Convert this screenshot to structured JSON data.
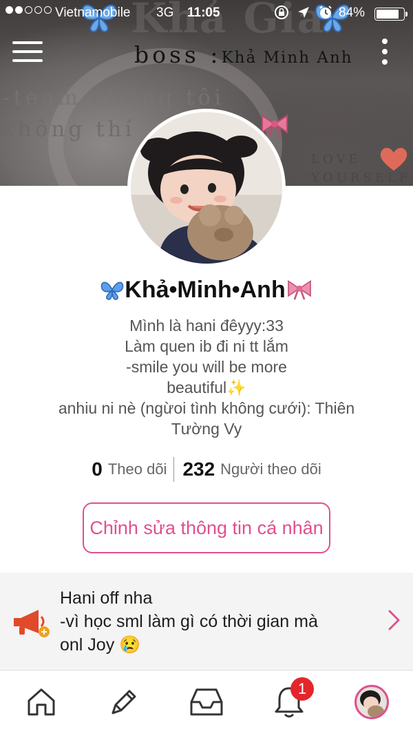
{
  "status_bar": {
    "carrier": "Vietnamobile",
    "network": "3G",
    "time": "11:05",
    "battery_percent": "84%",
    "battery_level": 0.84,
    "signal_bars_filled": 2,
    "signal_bars_total": 5
  },
  "banner": {
    "watermark_text": "Khả Gia",
    "boss_label": "boss :",
    "boss_name": "Khả Minh Anh",
    "team_line": "-team chúng tôi",
    "team_line2": "không thí",
    "love_line1": "LOVE",
    "love_line2": "YOURSELF"
  },
  "profile": {
    "name": "Khả•Minh•Anh",
    "name_prefix_emoji": "butterfly",
    "name_suffix_emoji": "ribbon",
    "bio_lines": [
      "Mình là hani đêyyy:33",
      "Làm quen ib đi ni tt lắm",
      "-smile you will be more",
      "beautiful✨",
      "anhiu ni nè (ngừoi tình không cưới): Thiên",
      "Tường Vy"
    ],
    "following_count": "0",
    "following_label": "Theo dõi",
    "followers_count": "232",
    "followers_label": "Người theo dõi",
    "edit_button_label": "Chỉnh sửa thông tin cá nhân"
  },
  "notice": {
    "lines": [
      "Hani off nha",
      "-vì học sml làm gì có thời gian mà",
      "onl Joy 😢"
    ]
  },
  "tabbar": {
    "notifications_badge": "1",
    "tabs": [
      "home-icon",
      "pencil-icon",
      "inbox-icon",
      "bell-icon",
      "profile-avatar"
    ]
  },
  "colors": {
    "accent_pink": "#e0508e",
    "badge_red": "#e3262c",
    "notice_bg": "#f4f4f4",
    "megaphone_red": "#e04a2a"
  }
}
